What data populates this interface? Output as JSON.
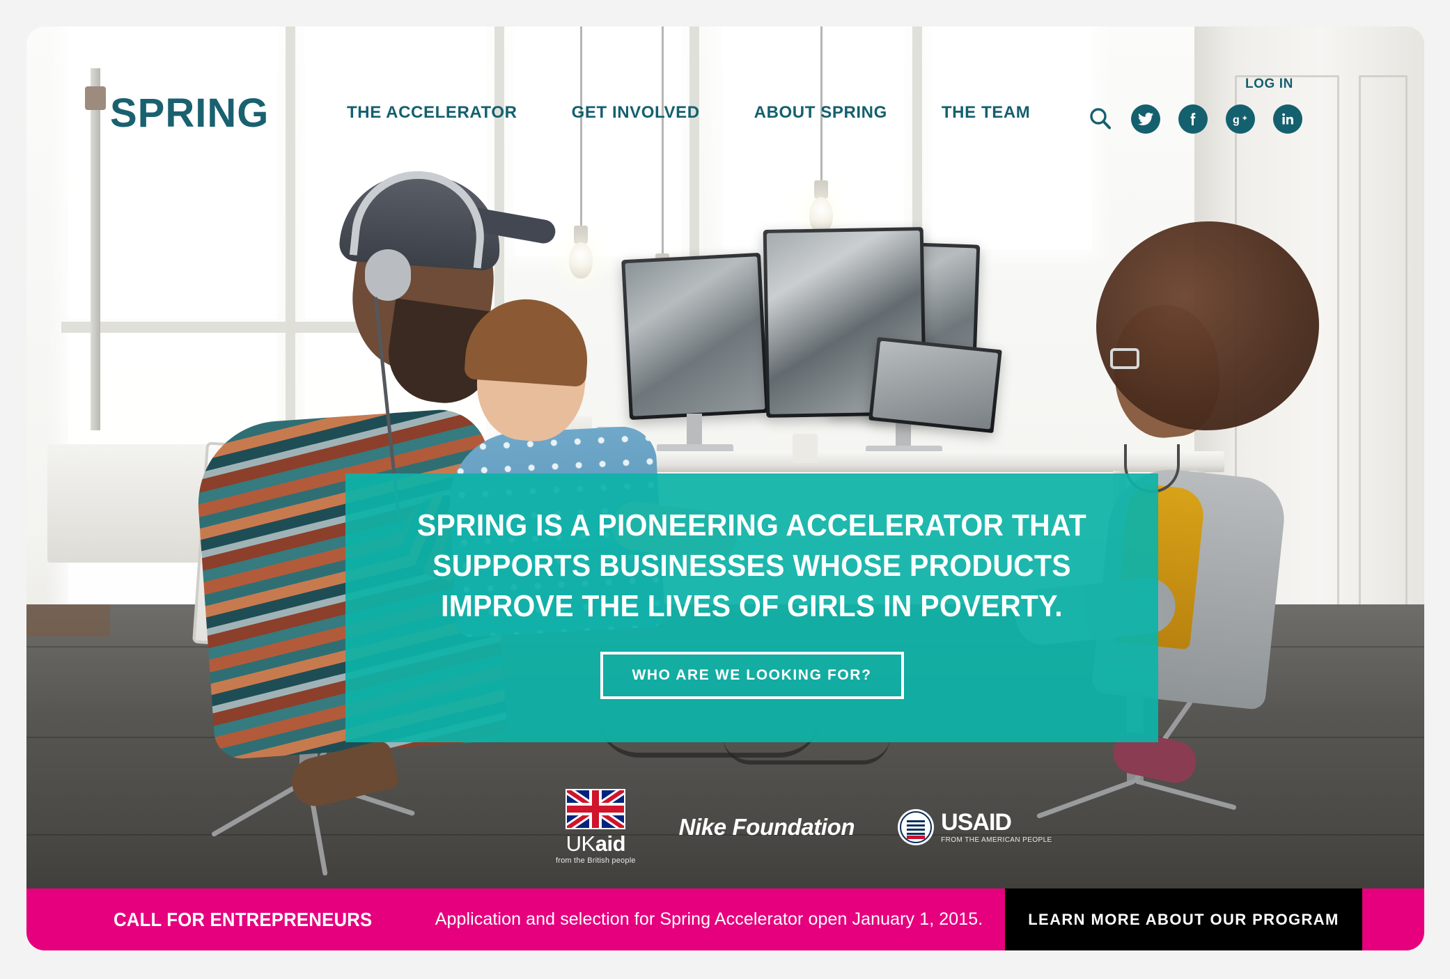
{
  "brand": {
    "logo_text": "SPRING",
    "teal": "#0db3a8",
    "dark_teal": "#14606e",
    "pink": "#e6007e",
    "black": "#000000"
  },
  "header": {
    "login_label": "LOG IN",
    "nav": [
      {
        "label": "THE ACCELERATOR",
        "name": "nav-the-accelerator"
      },
      {
        "label": "GET INVOLVED",
        "name": "nav-get-involved"
      },
      {
        "label": "ABOUT SPRING",
        "name": "nav-about-spring"
      },
      {
        "label": "THE TEAM",
        "name": "nav-the-team"
      }
    ],
    "icons": {
      "search": "search-icon",
      "twitter": "twitter-icon",
      "facebook": "facebook-icon",
      "googleplus": "google-plus-icon",
      "linkedin": "linkedin-icon"
    }
  },
  "hero": {
    "headline_lines": [
      "SPRING IS A PIONEERING ACCELERATOR THAT",
      "SUPPORTS BUSINESSES WHOSE PRODUCTS",
      "IMPROVE THE LIVES OF GIRLS IN POVERTY."
    ],
    "cta_label": "WHO ARE WE LOOKING FOR?"
  },
  "partners": {
    "ukaid": {
      "word_uk": "UK",
      "word_aid": "aid",
      "tagline": "from the British people"
    },
    "nike": {
      "name": "Nike Foundation"
    },
    "usaid": {
      "word": "USAID",
      "tagline": "FROM THE AMERICAN PEOPLE"
    }
  },
  "call_bar": {
    "title": "CALL FOR ENTREPRENEURS",
    "text": "Application and selection for Spring Accelerator open January 1, 2015.",
    "button_label": "LEARN MORE ABOUT OUR PROGRAM"
  }
}
